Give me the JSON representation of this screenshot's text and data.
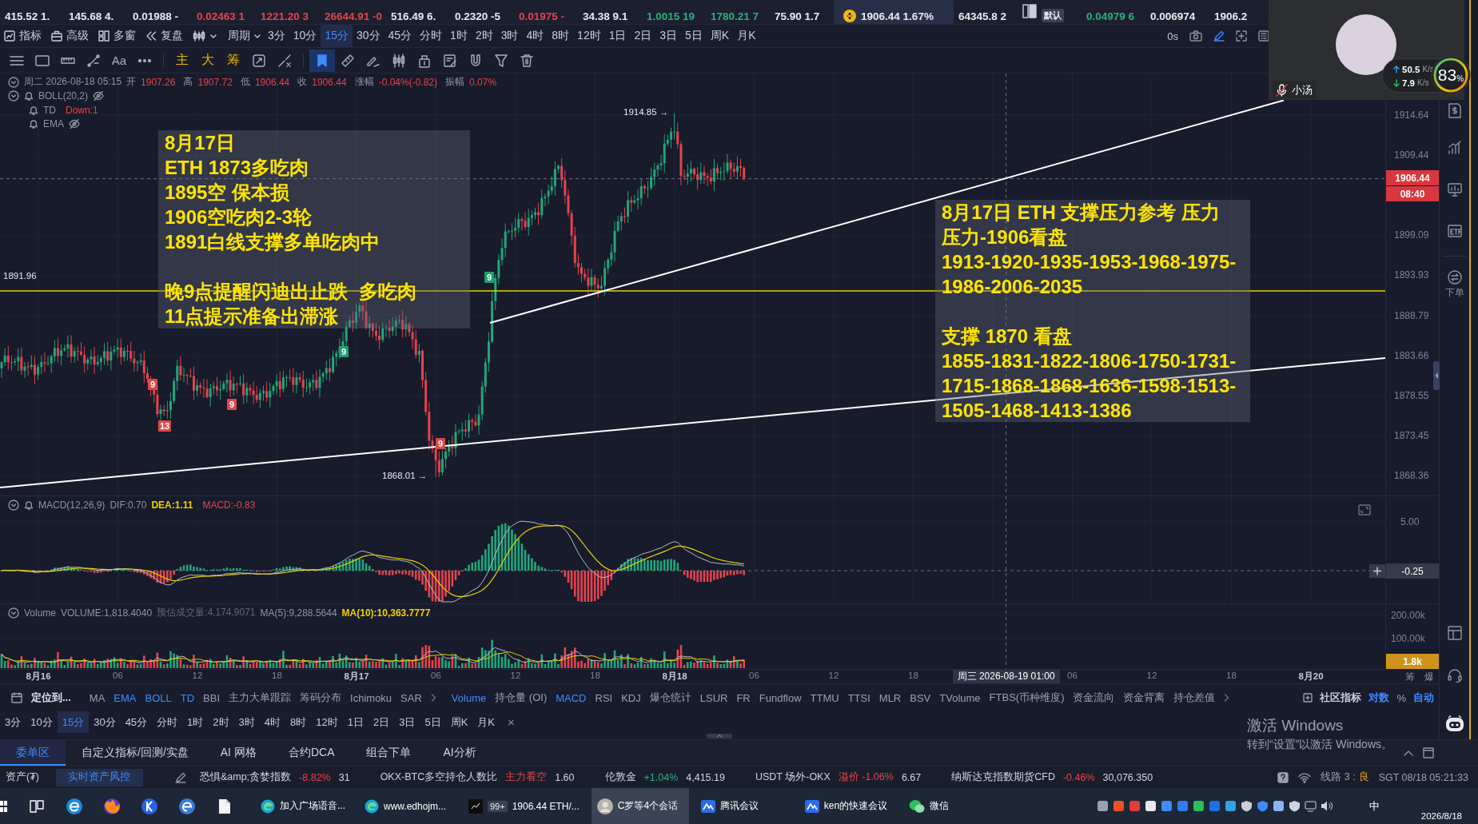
{
  "ticker": [
    {
      "kind": "quote",
      "price": "415.52 1.",
      "color": "#e8eaf0",
      "selected": false
    },
    {
      "kind": "quote",
      "price": "145.68 4.",
      "color": "#e8eaf0",
      "selected": false
    },
    {
      "kind": "quote",
      "price": "0.01988 -",
      "color": "#e8eaf0",
      "selected": false
    },
    {
      "kind": "quote",
      "price": "0.02463 1",
      "color": "#e5434d",
      "selected": false
    },
    {
      "kind": "quote",
      "price": "1221.20 3",
      "color": "#e5434d",
      "selected": false
    },
    {
      "kind": "quote",
      "price": "26644.91 -0",
      "color": "#e5434d",
      "selected": false
    },
    {
      "kind": "quote",
      "price": "516.49 6.",
      "color": "#e8eaf0",
      "selected": false
    },
    {
      "kind": "quote",
      "price": "0.2320 -5",
      "color": "#e8eaf0",
      "selected": false
    },
    {
      "kind": "quote",
      "price": "0.01975 -",
      "color": "#e5434d",
      "selected": false
    },
    {
      "kind": "quote",
      "price": "34.38 9.1",
      "color": "#e8eaf0",
      "selected": false
    },
    {
      "kind": "quote",
      "price": "1.0015 19",
      "color": "#26b07f",
      "selected": false
    },
    {
      "kind": "quote",
      "price": "1780.21 7",
      "color": "#26b07f",
      "selected": false
    },
    {
      "kind": "quote",
      "price": "75.90 1.7",
      "color": "#e8eaf0",
      "selected": false
    },
    {
      "kind": "coin",
      "price": "1906.44 1.67%",
      "color": "#e8eaf0",
      "selected": true
    },
    {
      "kind": "quote",
      "price": "64345.8 2",
      "color": "#e8eaf0",
      "selected": false
    },
    {
      "kind": "layout",
      "badge": "默认",
      "selected": false
    },
    {
      "kind": "quote",
      "price": "0.04979 6",
      "color": "#26b07f",
      "selected": false
    },
    {
      "kind": "quote",
      "price": "0.006974",
      "color": "#e8eaf0",
      "selected": false
    },
    {
      "kind": "quote",
      "price": "1906.2",
      "color": "#e8eaf0",
      "selected": false
    }
  ],
  "toolbar": {
    "tools": [
      "指标",
      "高级",
      "多窗",
      "复盘"
    ],
    "period_menu": "周期",
    "periods": [
      {
        "label": "3分",
        "selected": false
      },
      {
        "label": "10分",
        "selected": false
      },
      {
        "label": "15分",
        "selected": true
      },
      {
        "label": "30分",
        "selected": false
      },
      {
        "label": "45分",
        "selected": false
      },
      {
        "label": "分时",
        "selected": false
      },
      {
        "label": "1时",
        "selected": false
      },
      {
        "label": "2时",
        "selected": false
      },
      {
        "label": "3时",
        "selected": false
      },
      {
        "label": "4时",
        "selected": false
      },
      {
        "label": "8时",
        "selected": false
      },
      {
        "label": "12时",
        "selected": false
      },
      {
        "label": "1日",
        "selected": false
      },
      {
        "label": "2日",
        "selected": false
      },
      {
        "label": "3日",
        "selected": false
      },
      {
        "label": "5日",
        "selected": false
      },
      {
        "label": "周K",
        "selected": false
      },
      {
        "label": "月K",
        "selected": false
      }
    ],
    "countdown": "0s"
  },
  "drawing_bar": {
    "text_tool": "Aa",
    "layers": [
      "主",
      "大",
      "筹"
    ],
    "tools": [
      {
        "kind": "bookmark",
        "selected": true
      },
      {
        "kind": "ruler",
        "selected": false
      },
      {
        "kind": "pen",
        "selected": false
      },
      {
        "kind": "candles",
        "selected": false
      },
      {
        "kind": "lock",
        "selected": false
      },
      {
        "kind": "note",
        "selected": false
      },
      {
        "kind": "magnet",
        "selected": false
      },
      {
        "kind": "filter",
        "selected": false
      },
      {
        "kind": "trash",
        "selected": false
      }
    ]
  },
  "legend": {
    "time": "周二 2026-08-18 05:15",
    "fields": [
      {
        "label": "开",
        "value": "1907.26"
      },
      {
        "label": "高",
        "value": "1907.72"
      },
      {
        "label": "低",
        "value": "1906.44"
      },
      {
        "label": "收",
        "value": "1906.44"
      },
      {
        "label": "涨幅",
        "value": "-0.04%(-0.82)"
      },
      {
        "label": "振幅",
        "value": "0.07%"
      }
    ],
    "indicators": [
      {
        "name": "BOLL(20,2)",
        "hidden": true
      },
      {
        "name": "TD",
        "value": "Down:1",
        "hidden": false
      },
      {
        "name": "EMA",
        "hidden": true
      }
    ]
  },
  "notes": [
    {
      "paragraphs": [
        [
          "8月17日",
          "ETH 1873多吃肉",
          "1895空 保本损",
          "1906空吃肉2-3轮",
          "1891白线支撑多单吃肉中"
        ],
        [
          "晚9点提醒闪迪出止跌  多吃肉",
          "11点提示准备出滞涨"
        ]
      ]
    },
    {
      "paragraphs": [
        [
          "8月17日 ETH 支撑压力参考 压力",
          "压力-1906看盘",
          "1913-1920-1935-1953-1968-1975-",
          "1986-2006-2035"
        ],
        [
          "支撑 1870 看盘",
          "1855-1831-1822-1806-1750-1731-",
          "1715-1868-1868-1636-1598-1513-",
          "1505-1468-1413-1386"
        ]
      ]
    }
  ],
  "price_chart": {
    "level_label": "1891.96",
    "high_label": "1914.85 →",
    "low_label": "1868.01 →",
    "td_marks": [
      {
        "text": "9",
        "color": "#e04848"
      },
      {
        "text": "13",
        "color": "#e04848"
      },
      {
        "text": "9",
        "color": "#e04848"
      },
      {
        "text": "9",
        "color": "#1f9e74"
      },
      {
        "text": "9",
        "color": "#e04848"
      },
      {
        "text": "9",
        "color": "#1f9e74"
      }
    ],
    "axis_ticks": [
      "1914.64",
      "1909.44",
      "1899.09",
      "1893.93",
      "1888.79",
      "1883.66",
      "1878.55",
      "1873.45",
      "1868.36"
    ],
    "last_price": "1906.44",
    "countdown": "08:40"
  },
  "macd": {
    "name": "MACD(12,26,9)",
    "dif": "DIF:0.70",
    "dea": "DEA:1.11",
    "macd": "MACD:-0.83",
    "axis_ticks": [
      "5.00"
    ],
    "cursor_value": "-0.25"
  },
  "volume": {
    "name": "Volume",
    "volume": "VOLUME:1,818.4040",
    "estimate": "预估成交量:4,174.9071",
    "ma5": "MA(5):9,288.5644",
    "ma10": "MA(10):10,363.7777",
    "axis_ticks": [
      "200.00k",
      "100.00k"
    ],
    "last_value": "1.8k"
  },
  "x_axis": {
    "labels": [
      {
        "text": "8月16",
        "kind": "day"
      },
      {
        "text": "06",
        "kind": "hour"
      },
      {
        "text": "12",
        "kind": "hour"
      },
      {
        "text": "18",
        "kind": "hour"
      },
      {
        "text": "8月17",
        "kind": "day"
      },
      {
        "text": "06",
        "kind": "hour"
      },
      {
        "text": "12",
        "kind": "hour"
      },
      {
        "text": "18",
        "kind": "hour"
      },
      {
        "text": "8月18",
        "kind": "day"
      },
      {
        "text": "06",
        "kind": "hour"
      },
      {
        "text": "12",
        "kind": "hour"
      },
      {
        "text": "18",
        "kind": "hour"
      },
      {
        "text": "周三 2026-08-19 01:00",
        "kind": "cursor"
      },
      {
        "text": "06",
        "kind": "hour"
      },
      {
        "text": "12",
        "kind": "hour"
      },
      {
        "text": "18",
        "kind": "hour"
      },
      {
        "text": "8月20",
        "kind": "day"
      }
    ],
    "extras": [
      "筹",
      "爆"
    ]
  },
  "indicator_bar": {
    "locate": "定位到...",
    "main": [
      {
        "label": "MA",
        "selected": false
      },
      {
        "label": "EMA",
        "selected": true
      },
      {
        "label": "BOLL",
        "selected": true
      },
      {
        "label": "TD",
        "selected": true
      },
      {
        "label": "BBI",
        "selected": false
      },
      {
        "label": "主力大单跟踪",
        "selected": false
      },
      {
        "label": "筹码分布",
        "selected": false
      },
      {
        "label": "Ichimoku",
        "selected": false
      },
      {
        "label": "SAR",
        "selected": false
      }
    ],
    "sub": [
      {
        "label": "Volume",
        "selected": true
      },
      {
        "label": "持仓量 (OI)",
        "selected": false
      },
      {
        "label": "MACD",
        "selected": true
      },
      {
        "label": "RSI",
        "selected": false
      },
      {
        "label": "KDJ",
        "selected": false
      },
      {
        "label": "爆仓统计",
        "selected": false
      },
      {
        "label": "LSUR",
        "selected": false
      },
      {
        "label": "FR",
        "selected": false
      },
      {
        "label": "Fundflow",
        "selected": false
      },
      {
        "label": "TTMU",
        "selected": false
      },
      {
        "label": "TTSI",
        "selected": false
      },
      {
        "label": "MLR",
        "selected": false
      },
      {
        "label": "BSV",
        "selected": false
      },
      {
        "label": "TVolume",
        "selected": false
      },
      {
        "label": "FTBS(币种维度)",
        "selected": false
      },
      {
        "label": "资金流向",
        "selected": false
      },
      {
        "label": "资金背离",
        "selected": false
      },
      {
        "label": "持仓差值",
        "selected": false
      }
    ],
    "community": "社区指标",
    "options": [
      {
        "label": "对数",
        "selected": true
      },
      {
        "label": "%",
        "selected": false
      },
      {
        "label": "自动",
        "selected": true
      }
    ]
  },
  "period_bar": {
    "periods": [
      {
        "label": "3分",
        "selected": false
      },
      {
        "label": "10分",
        "selected": false
      },
      {
        "label": "15分",
        "selected": true
      },
      {
        "label": "30分",
        "selected": false
      },
      {
        "label": "45分",
        "selected": false
      },
      {
        "label": "分时",
        "selected": false
      },
      {
        "label": "1时",
        "selected": false
      },
      {
        "label": "2时",
        "selected": false
      },
      {
        "label": "3时",
        "selected": false
      },
      {
        "label": "4时",
        "selected": false
      },
      {
        "label": "8时",
        "selected": false
      },
      {
        "label": "12时",
        "selected": false
      },
      {
        "label": "1日",
        "selected": false
      },
      {
        "label": "2日",
        "selected": false
      },
      {
        "label": "3日",
        "selected": false
      },
      {
        "label": "5日",
        "selected": false
      },
      {
        "label": "周K",
        "selected": false
      },
      {
        "label": "月K",
        "selected": false
      }
    ],
    "close": "×"
  },
  "panel_tabs": [
    {
      "label": "委单区",
      "selected": true
    },
    {
      "label": "自定义指标/回测/实盘",
      "selected": false
    },
    {
      "label": "AI 网格",
      "selected": false
    },
    {
      "label": "合约DCA",
      "selected": false
    },
    {
      "label": "组合下单",
      "selected": false
    },
    {
      "label": "AI分析",
      "selected": false
    }
  ],
  "windows_notice": {
    "title": "激活 Windows",
    "text": "转到“设置”以激活 Windows。"
  },
  "status_bar": {
    "asset": "资产(₮)",
    "risk_button": "实时资产风控",
    "items": [
      {
        "label": "恐惧&amp;贪婪指数",
        "change": "-8.82%",
        "color": "#e5434d",
        "value": "31"
      },
      {
        "label": "OKX-BTC多空持仓人数比",
        "change": "主力看空",
        "color": "#e5434d",
        "value": "1.60"
      },
      {
        "label": "伦敦金",
        "change": "+1.04%",
        "color": "#26b07f",
        "value": "4,415.19"
      },
      {
        "label": "USDT 场外-OKX",
        "change": "溢价 -1.06%",
        "color": "#e5434d",
        "value": "6.67"
      },
      {
        "label": "纳斯达克指数期货CFD",
        "change": "-0.46%",
        "color": "#e5434d",
        "value": "30,076.350"
      }
    ],
    "line_label": "线路 3 :",
    "line_quality": "良",
    "clock": "SGT 08/18 05:21:33"
  },
  "taskbar": {
    "apps": [
      {
        "kind": "edge",
        "label": "加入广场语音...",
        "selected": false
      },
      {
        "kind": "edge",
        "label": "www.edhojm...",
        "selected": false
      },
      {
        "kind": "app",
        "label": "1906.44 ETH/...",
        "badge": "99+",
        "selected": false
      },
      {
        "kind": "chat",
        "label": "C罗等4个会话",
        "selected": true
      },
      {
        "kind": "meeting",
        "label": "腾讯会议",
        "selected": false
      },
      {
        "kind": "meeting",
        "label": "ken的快速会议",
        "selected": false
      },
      {
        "kind": "wechat",
        "label": "微信",
        "selected": false
      }
    ],
    "ime": "中",
    "date": "2026/8/18"
  },
  "video_call": {
    "caller": "小汤",
    "muted": true,
    "upload": "50.5",
    "upload_unit": "K/s",
    "download": "7.9",
    "download_unit": "K/s",
    "load": "83",
    "load_unit": "%"
  },
  "sidebar": {
    "order_label": "下单"
  }
}
